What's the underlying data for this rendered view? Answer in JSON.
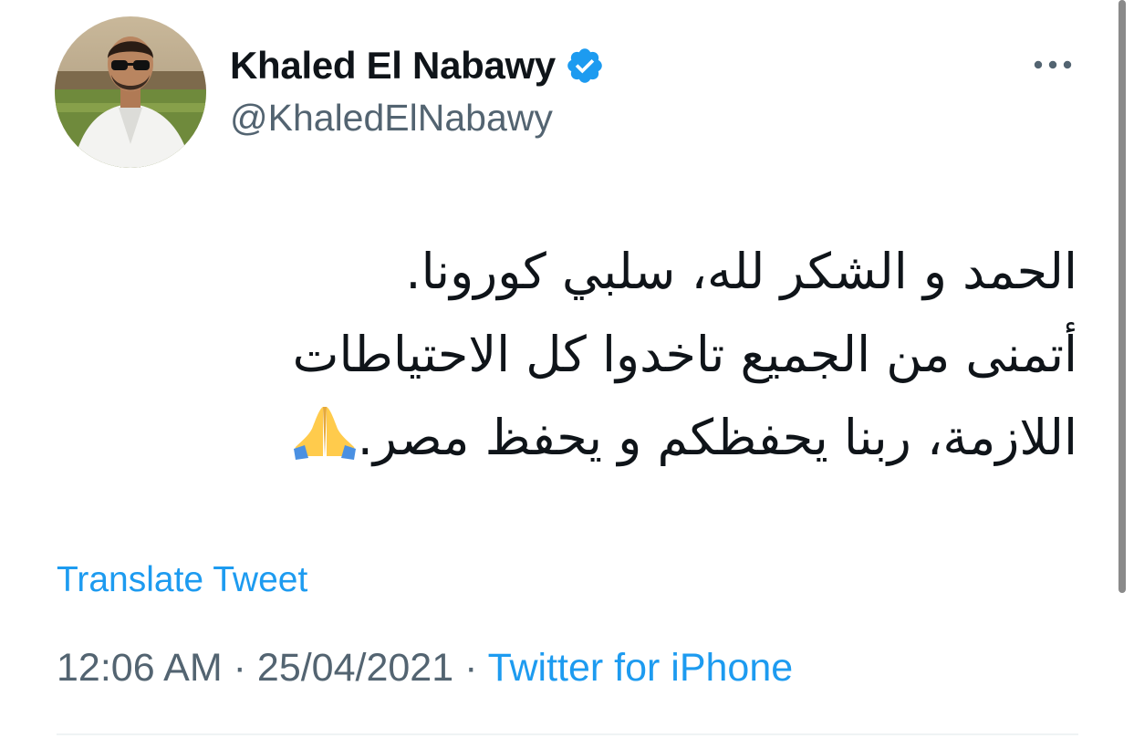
{
  "tweet": {
    "author": {
      "display_name": "Khaled El Nabawy",
      "handle": "@KhaledElNabawy",
      "verified": true,
      "avatar_icon": "profile-photo"
    },
    "more_icon": "ellipsis-icon",
    "text_lines": [
      "الحمد و الشكر لله، سلبي كورونا.",
      "أتمنى من الجميع تاخدوا كل الاحتياطات",
      "اللازمة، ربنا يحفظكم و يحفظ مصر."
    ],
    "emoji": "folded-hands-emoji",
    "translate_label": "Translate Tweet",
    "time": "12:06 AM",
    "separator": " · ",
    "date": "25/04/2021",
    "source": "Twitter for iPhone"
  },
  "colors": {
    "text_primary": "#0f1419",
    "text_secondary": "#536471",
    "link": "#1d9bf0",
    "verified_badge": "#1d9bf0"
  }
}
